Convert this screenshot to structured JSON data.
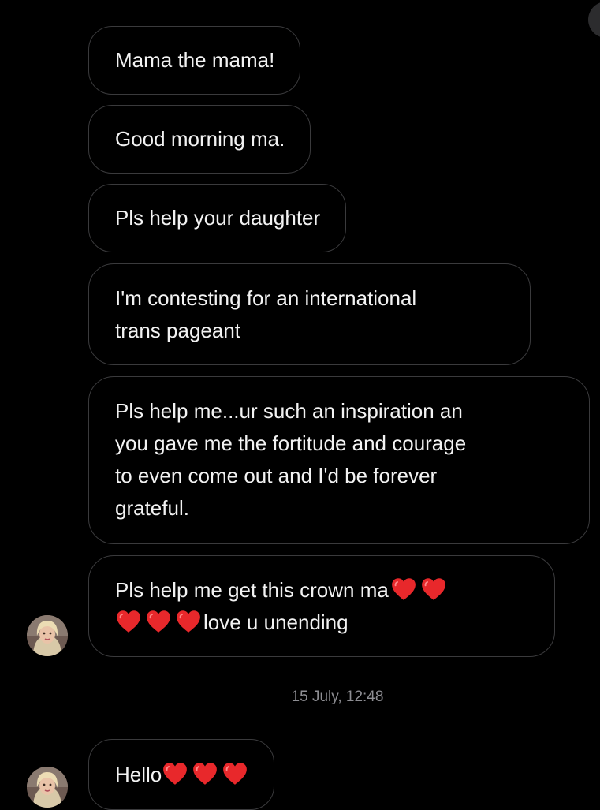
{
  "messages": [
    {
      "lines": [
        "Mama the mama!"
      ]
    },
    {
      "lines": [
        "Good morning ma."
      ]
    },
    {
      "lines": [
        "Pls help your daughter"
      ]
    },
    {
      "lines": [
        "I'm contesting for an international",
        "trans pageant"
      ]
    },
    {
      "lines": [
        "Pls help me...ur such an inspiration an",
        "you gave me the fortitude and courage",
        "to even come out and I'd be forever",
        "grateful."
      ]
    },
    {
      "line1": "Pls help me get this crown ma",
      "line2": "love u unending"
    },
    {
      "text": "Hello"
    }
  ],
  "timestamp": "15 July, 12:48",
  "colors": {
    "background": "#000000",
    "bubble_border": "#3a3a3c",
    "text": "#f2f2f2",
    "timestamp": "#8e8e93",
    "heart": "#e8282b"
  },
  "icons": {
    "heart": "red-heart-emoji",
    "avatar": "user-avatar"
  }
}
